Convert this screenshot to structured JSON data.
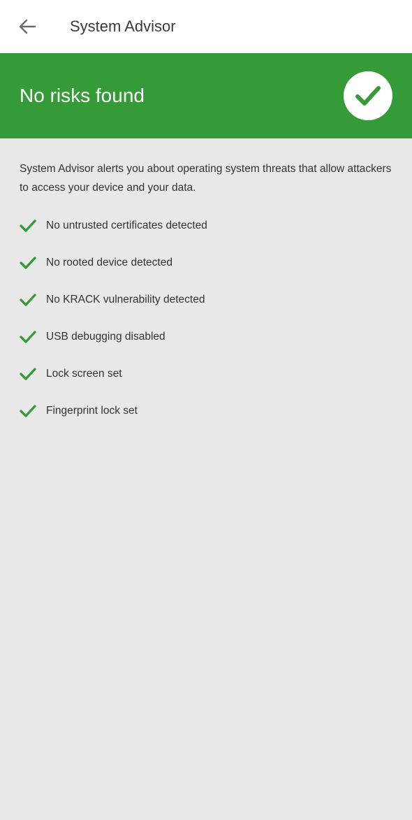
{
  "colors": {
    "accent_green": "#359b38",
    "background": "#e8e8e8",
    "app_bar": "#ffffff"
  },
  "header": {
    "back_icon": "arrow-left-icon",
    "title": "System Advisor"
  },
  "banner": {
    "status_text": "No risks found",
    "status_icon": "check-circle-icon"
  },
  "main": {
    "description": "System Advisor alerts you about operating system threats that allow attackers to access your device and your data.",
    "checks": [
      {
        "label": "No untrusted certificates detected",
        "icon": "check-icon"
      },
      {
        "label": "No rooted device detected",
        "icon": "check-icon"
      },
      {
        "label": "No KRACK vulnerability detected",
        "icon": "check-icon"
      },
      {
        "label": "USB debugging disabled",
        "icon": "check-icon"
      },
      {
        "label": "Lock screen set",
        "icon": "check-icon"
      },
      {
        "label": "Fingerprint lock set",
        "icon": "check-icon"
      }
    ]
  }
}
